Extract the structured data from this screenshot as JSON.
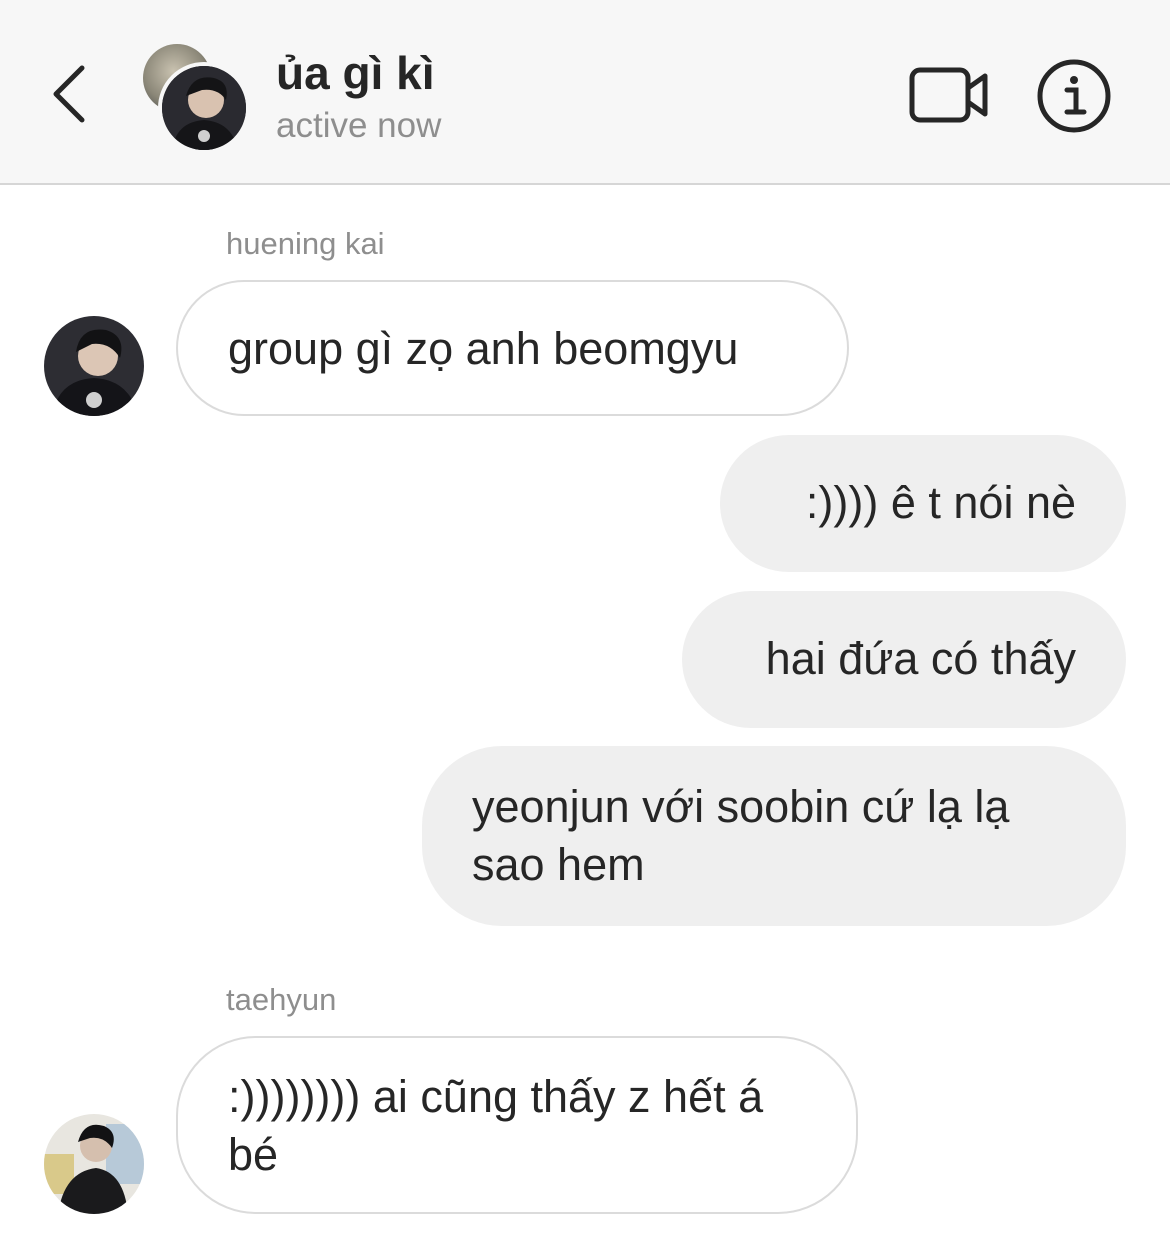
{
  "header": {
    "title": "ủa gì kì",
    "status": "active now",
    "back_icon": "chevron-left-icon",
    "video_icon": "video-camera-icon",
    "info_icon": "info-circle-icon"
  },
  "messages": [
    {
      "sender": "huening kai",
      "text": "group gì zọ anh beomgyu",
      "direction": "incoming"
    },
    {
      "text": ":)))) ê t nói nè",
      "direction": "outgoing"
    },
    {
      "text": "hai đứa có thấy",
      "direction": "outgoing"
    },
    {
      "text": "yeonjun với soobin cứ lạ lạ sao hem",
      "direction": "outgoing"
    },
    {
      "sender": "taehyun",
      "text": ":)))))))) ai cũng thấy z hết á bé",
      "direction": "incoming"
    }
  ],
  "colors": {
    "header_bg": "#f7f7f7",
    "outgoing_bubble": "#efefef",
    "incoming_border": "#dbdbdb",
    "secondary_text": "#8e8e8e",
    "primary_text": "#262626"
  }
}
